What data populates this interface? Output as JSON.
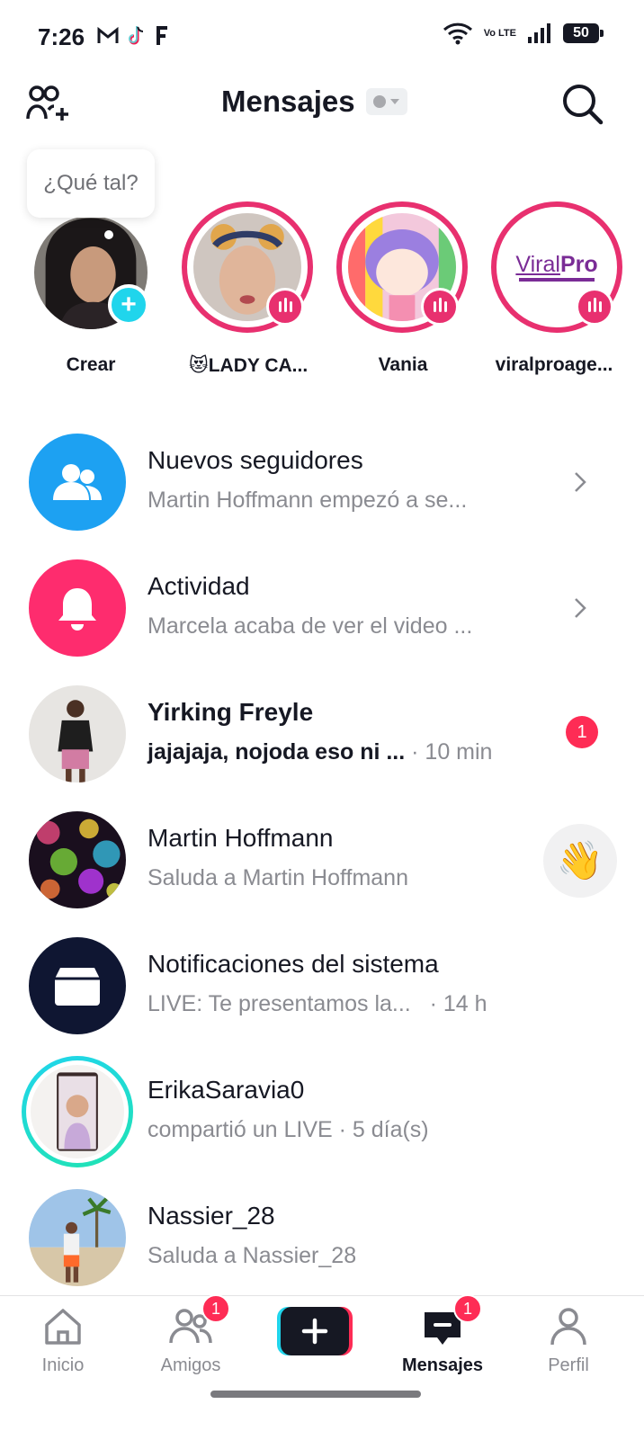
{
  "status_bar": {
    "time": "7:26",
    "battery": "50",
    "network": "Vo LTE"
  },
  "header": {
    "title": "Mensajes"
  },
  "stories": {
    "bubble_text": "¿Qué tal?",
    "items": [
      {
        "name": "Crear"
      },
      {
        "name": "😻LADY CA..."
      },
      {
        "name": "Vania"
      },
      {
        "name": "viralproage..."
      }
    ],
    "viralpro_logo": {
      "part1": "Viral",
      "part2": "Pro"
    }
  },
  "conversations": [
    {
      "title": "Nuevos seguidores",
      "subtitle": "Martin Hoffmann empezó a se..."
    },
    {
      "title": "Actividad",
      "subtitle": "Marcela acaba de ver el video ..."
    },
    {
      "title": "Yirking Freyle",
      "subtitle": "jajajaja, nojoda eso ni ...",
      "time": "· 10 min",
      "unread": "1"
    },
    {
      "title": "Martin Hoffmann",
      "subtitle": "Saluda a Martin Hoffmann",
      "action_emoji": "👋"
    },
    {
      "title": "Notificaciones del sistema",
      "subtitle": "LIVE: Te presentamos la...",
      "time": "· 14 h"
    },
    {
      "title": "ErikaSaravia0",
      "subtitle": "compartió un LIVE · 5 día(s)"
    },
    {
      "title": "Nassier_28",
      "subtitle": "Saluda a Nassier_28"
    }
  ],
  "tabbar": {
    "items": [
      {
        "label": "Inicio"
      },
      {
        "label": "Amigos",
        "badge": "1"
      },
      {
        "label": "Mensajes",
        "badge": "1"
      },
      {
        "label": "Perfil"
      }
    ]
  },
  "colors": {
    "accent_pink": "#e8306f",
    "badge_red": "#fe2c55",
    "followers_blue": "#1da1f2",
    "system_navy": "#0f1632",
    "live_cyan": "#20d5ec"
  }
}
